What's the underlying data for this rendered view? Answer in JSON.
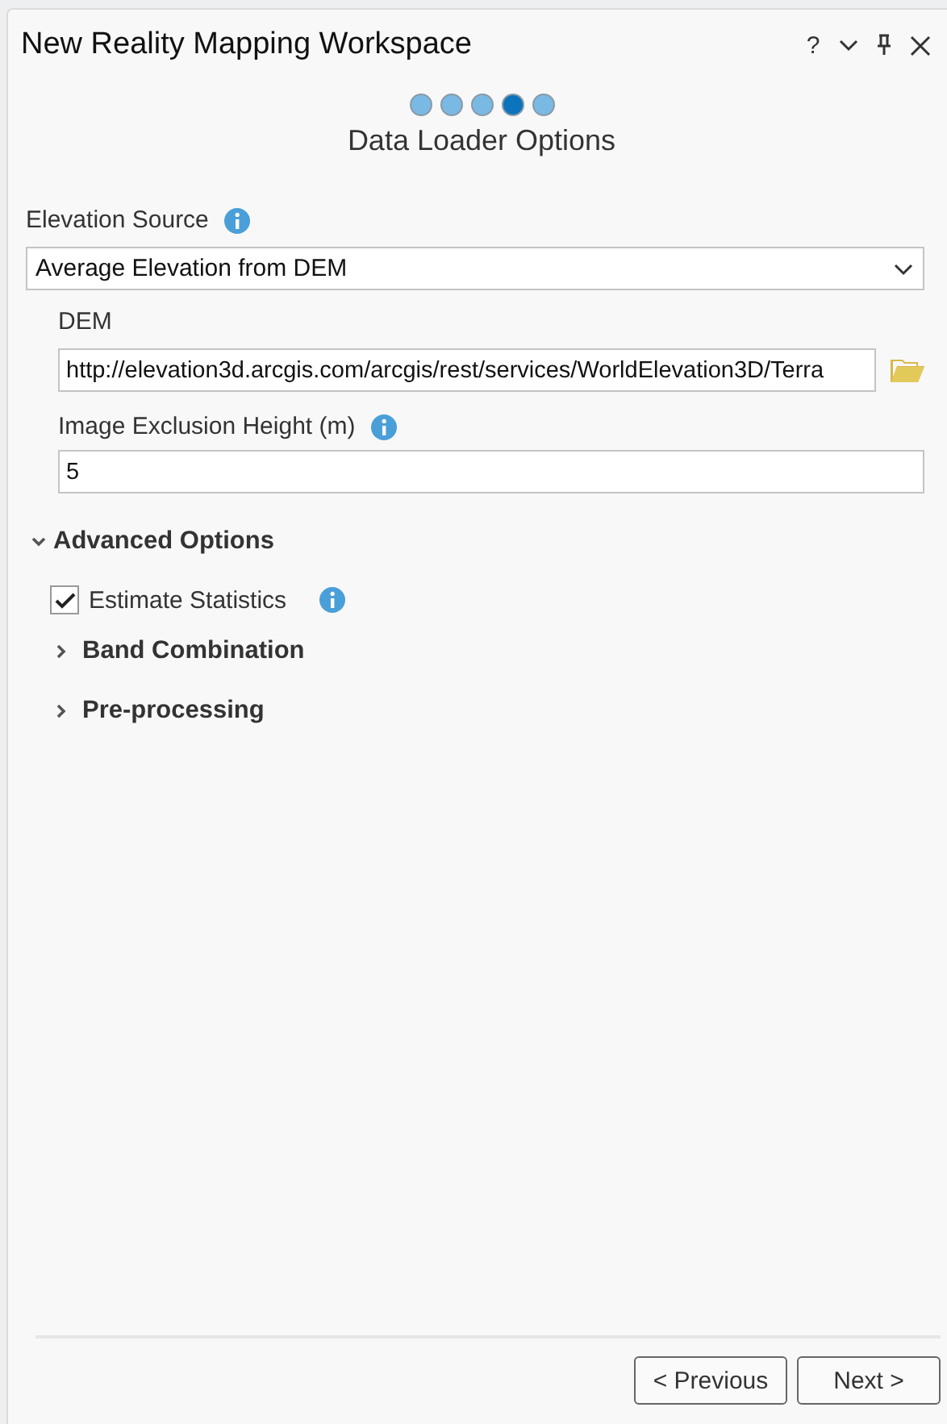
{
  "window": {
    "title": "New Reality Mapping Workspace",
    "help": "?"
  },
  "steps": [
    {
      "selected": false
    },
    {
      "selected": false
    },
    {
      "selected": false
    },
    {
      "selected": true
    },
    {
      "selected": false
    }
  ],
  "page_title": "Data Loader Options",
  "elevation_source": {
    "label": "Elevation Source",
    "value": "Average Elevation from DEM"
  },
  "dem": {
    "label": "DEM",
    "value": "http://elevation3d.arcgis.com/arcgis/rest/services/WorldElevation3D/Terra"
  },
  "exclusion_height": {
    "label": "Image Exclusion Height (m)",
    "value": "5"
  },
  "advanced": {
    "label": "Advanced Options",
    "expanded": true,
    "children": [
      {
        "kind": "checkbox",
        "label": "Estimate Statistics",
        "checked": true
      },
      {
        "kind": "section",
        "label": "Band Combination",
        "expanded": false
      },
      {
        "kind": "section",
        "label": "Pre-processing",
        "expanded": false
      }
    ]
  },
  "buttons": [
    "< Previous",
    "Next >"
  ]
}
